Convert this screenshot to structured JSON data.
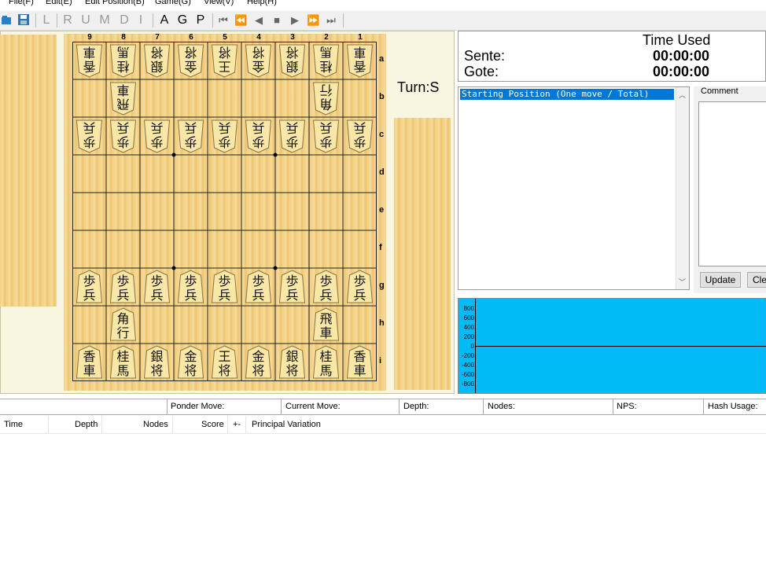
{
  "menu": [
    "File(F)",
    "Edit(E)",
    "Edit Position(B)",
    "Game(G)",
    "View(V)",
    "Help(H)"
  ],
  "toolbar": {
    "letters_dim": [
      "L",
      "R",
      "U",
      "M",
      "D",
      "I"
    ],
    "letters_on": [
      "A",
      "G",
      "P"
    ]
  },
  "board": {
    "columns": [
      "9",
      "8",
      "7",
      "6",
      "5",
      "4",
      "3",
      "2",
      "1"
    ],
    "rows": [
      "a",
      "b",
      "c",
      "d",
      "e",
      "f",
      "g",
      "h",
      "i"
    ],
    "pieces": [
      {
        "file": 9,
        "rank": 1,
        "t1": "香",
        "t2": "車",
        "side": "gote"
      },
      {
        "file": 8,
        "rank": 1,
        "t1": "桂",
        "t2": "馬",
        "side": "gote"
      },
      {
        "file": 7,
        "rank": 1,
        "t1": "銀",
        "t2": "将",
        "side": "gote"
      },
      {
        "file": 6,
        "rank": 1,
        "t1": "金",
        "t2": "将",
        "side": "gote"
      },
      {
        "file": 5,
        "rank": 1,
        "t1": "王",
        "t2": "将",
        "side": "gote"
      },
      {
        "file": 4,
        "rank": 1,
        "t1": "金",
        "t2": "将",
        "side": "gote"
      },
      {
        "file": 3,
        "rank": 1,
        "t1": "銀",
        "t2": "将",
        "side": "gote"
      },
      {
        "file": 2,
        "rank": 1,
        "t1": "桂",
        "t2": "馬",
        "side": "gote"
      },
      {
        "file": 1,
        "rank": 1,
        "t1": "香",
        "t2": "車",
        "side": "gote"
      },
      {
        "file": 8,
        "rank": 2,
        "t1": "飛",
        "t2": "車",
        "side": "gote"
      },
      {
        "file": 2,
        "rank": 2,
        "t1": "角",
        "t2": "行",
        "side": "gote"
      },
      {
        "file": 9,
        "rank": 3,
        "t1": "歩",
        "t2": "兵",
        "side": "gote"
      },
      {
        "file": 8,
        "rank": 3,
        "t1": "歩",
        "t2": "兵",
        "side": "gote"
      },
      {
        "file": 7,
        "rank": 3,
        "t1": "歩",
        "t2": "兵",
        "side": "gote"
      },
      {
        "file": 6,
        "rank": 3,
        "t1": "歩",
        "t2": "兵",
        "side": "gote"
      },
      {
        "file": 5,
        "rank": 3,
        "t1": "歩",
        "t2": "兵",
        "side": "gote"
      },
      {
        "file": 4,
        "rank": 3,
        "t1": "歩",
        "t2": "兵",
        "side": "gote"
      },
      {
        "file": 3,
        "rank": 3,
        "t1": "歩",
        "t2": "兵",
        "side": "gote"
      },
      {
        "file": 2,
        "rank": 3,
        "t1": "歩",
        "t2": "兵",
        "side": "gote"
      },
      {
        "file": 1,
        "rank": 3,
        "t1": "歩",
        "t2": "兵",
        "side": "gote"
      },
      {
        "file": 9,
        "rank": 7,
        "t1": "歩",
        "t2": "兵",
        "side": "sente"
      },
      {
        "file": 8,
        "rank": 7,
        "t1": "歩",
        "t2": "兵",
        "side": "sente"
      },
      {
        "file": 7,
        "rank": 7,
        "t1": "歩",
        "t2": "兵",
        "side": "sente"
      },
      {
        "file": 6,
        "rank": 7,
        "t1": "歩",
        "t2": "兵",
        "side": "sente"
      },
      {
        "file": 5,
        "rank": 7,
        "t1": "歩",
        "t2": "兵",
        "side": "sente"
      },
      {
        "file": 4,
        "rank": 7,
        "t1": "歩",
        "t2": "兵",
        "side": "sente"
      },
      {
        "file": 3,
        "rank": 7,
        "t1": "歩",
        "t2": "兵",
        "side": "sente"
      },
      {
        "file": 2,
        "rank": 7,
        "t1": "歩",
        "t2": "兵",
        "side": "sente"
      },
      {
        "file": 1,
        "rank": 7,
        "t1": "歩",
        "t2": "兵",
        "side": "sente"
      },
      {
        "file": 8,
        "rank": 8,
        "t1": "角",
        "t2": "行",
        "side": "sente"
      },
      {
        "file": 2,
        "rank": 8,
        "t1": "飛",
        "t2": "車",
        "side": "sente"
      },
      {
        "file": 9,
        "rank": 9,
        "t1": "香",
        "t2": "車",
        "side": "sente"
      },
      {
        "file": 8,
        "rank": 9,
        "t1": "桂",
        "t2": "馬",
        "side": "sente"
      },
      {
        "file": 7,
        "rank": 9,
        "t1": "銀",
        "t2": "将",
        "side": "sente"
      },
      {
        "file": 6,
        "rank": 9,
        "t1": "金",
        "t2": "将",
        "side": "sente"
      },
      {
        "file": 5,
        "rank": 9,
        "t1": "王",
        "t2": "将",
        "side": "sente"
      },
      {
        "file": 4,
        "rank": 9,
        "t1": "金",
        "t2": "将",
        "side": "sente"
      },
      {
        "file": 3,
        "rank": 9,
        "t1": "銀",
        "t2": "将",
        "side": "sente"
      },
      {
        "file": 2,
        "rank": 9,
        "t1": "桂",
        "t2": "馬",
        "side": "sente"
      },
      {
        "file": 1,
        "rank": 9,
        "t1": "香",
        "t2": "車",
        "side": "sente"
      }
    ]
  },
  "turn": "Turn:S",
  "time": {
    "header": "Time Used",
    "sente_label": "Sente:",
    "sente_value": "00:00:00",
    "gote_label": "Gote:",
    "gote_value": "00:00:00"
  },
  "kifu": {
    "selected": "Starting Position (One move / Total)"
  },
  "comment": {
    "label": "Comment",
    "update": "Update",
    "clear": "Cle"
  },
  "graph": {
    "labels": [
      "800",
      "600",
      "400",
      "200",
      "0",
      "-200",
      "-400",
      "-600",
      "-800"
    ]
  },
  "status": {
    "ponder": "Ponder Move:",
    "current": "Current Move:",
    "depth": "Depth:",
    "nodes": "Nodes:",
    "nps": "NPS:",
    "hash": "Hash Usage:"
  },
  "pv_header": {
    "time": "Time",
    "depth": "Depth",
    "nodes": "Nodes",
    "score": "Score",
    "arrow": "+-",
    "pv": "Principal Variation"
  },
  "colors": {
    "selection": "#0078d7",
    "graph_bg": "#00bbf6",
    "piece": "#f9e7a8"
  }
}
